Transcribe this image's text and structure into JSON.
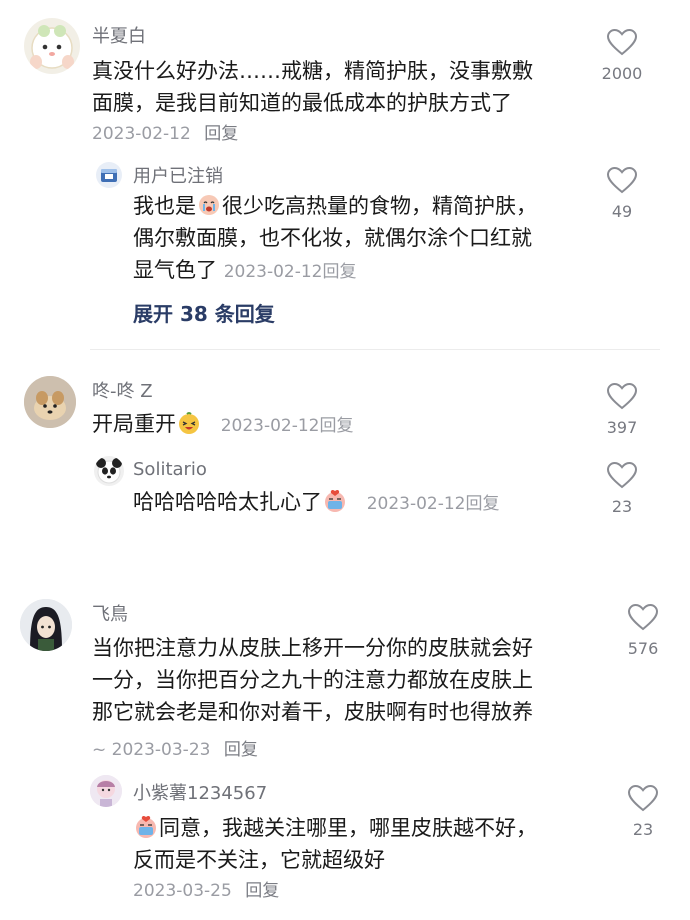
{
  "comments": [
    {
      "user": "半夏白",
      "text_line1": "真没什么好办法……戒糖，精简护肤，没事敷敷",
      "text_line2": "面膜，是我目前知道的最低成本的护肤方式了",
      "date": "2023-02-12",
      "reply_label": "回复",
      "likes": "2000",
      "replies": [
        {
          "user": "用户已注销",
          "text_pre": "我也是",
          "emoji": "crying-face-icon",
          "text_line1_rest": "很少吃高热量的食物，精简护肤，",
          "text_line2": "偶尔敷面膜，也不化妆，就偶尔涂个口红就",
          "text_line3": "显气色了",
          "date": "2023-02-12",
          "reply_label": "回复",
          "likes": "49"
        }
      ],
      "expand_label": "展开 38 条回复"
    },
    {
      "user": "咚-咚 Z",
      "text": "开局重开",
      "emoji": "laughing-face-icon",
      "date": "2023-02-12",
      "reply_label": "回复",
      "likes": "397",
      "replies": [
        {
          "user": "Solitario",
          "text": "哈哈哈哈哈太扎心了",
          "emoji": "crying-heart-icon",
          "date": "2023-02-12",
          "reply_label": "回复",
          "likes": "23"
        }
      ]
    },
    {
      "user": "飞鳥",
      "text_line1": "当你把注意力从皮肤上移开一分你的皮肤就会好",
      "text_line2": "一分，当你把百分之九十的注意力都放在皮肤上",
      "text_line3": "那它就会老是和你对着干，皮肤啊有时也得放养",
      "meta_prefix": "~",
      "date": "2023-03-23",
      "reply_label": "回复",
      "likes": "576",
      "replies": [
        {
          "user": "小紫薯1234567",
          "emoji": "crying-heart-icon",
          "text_line1_rest": "同意，我越关注哪里，哪里皮肤越不好，",
          "text_line2": "反而是不关注，它就超级好",
          "date": "2023-03-25",
          "reply_label": "回复",
          "likes": "23"
        }
      ]
    }
  ],
  "colors": {
    "text": "#1a1a1a",
    "meta": "#9a9ca3",
    "name": "#6f7178",
    "expand": "#2a3c66",
    "divider": "#ececec"
  }
}
